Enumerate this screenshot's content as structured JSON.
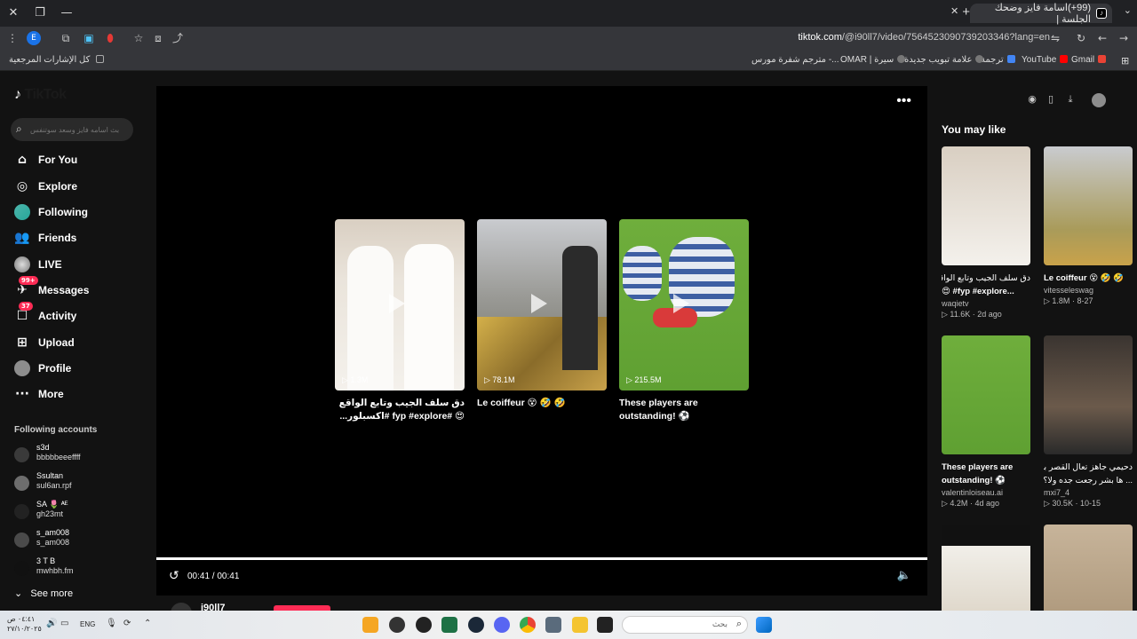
{
  "browser": {
    "tab_title": "(99+)اسامة فايز وضحك الجلسة |",
    "url_host": "tiktok.com",
    "url_path": "/@i90ll7/video/7564523090739203346?lang=en",
    "bookmarks": [
      {
        "label": "كل الإشارات المرجعية",
        "color": "#9aa0a6"
      },
      {
        "label": "Gmail",
        "color": "#ea4335"
      },
      {
        "label": "YouTube",
        "color": "#ff0000"
      },
      {
        "label": "ترجمة",
        "color": "#4285f4"
      },
      {
        "label": "علامة تبويب جديدة",
        "color": "#9aa0a6"
      },
      {
        "label": "OMAR | سيرة",
        "color": "#9aa0a6"
      },
      {
        "label": "مترجم شفرة مورس -...",
        "color": "#9aa0a6"
      }
    ]
  },
  "sidebar": {
    "logo": "TikTok",
    "search_placeholder": "بث اسامه فايز وسعد سوتنفس",
    "nav": [
      {
        "label": "For You",
        "icon": "home-icon"
      },
      {
        "label": "Explore",
        "icon": "compass-icon"
      },
      {
        "label": "Following",
        "icon": "following-avatar"
      },
      {
        "label": "Friends",
        "icon": "friends-icon"
      },
      {
        "label": "LIVE",
        "icon": "live-avatar"
      },
      {
        "label": "Messages",
        "icon": "messages-icon",
        "badge": "99+"
      },
      {
        "label": "Activity",
        "icon": "activity-icon",
        "badge": "37"
      },
      {
        "label": "Upload",
        "icon": "upload-icon"
      },
      {
        "label": "Profile",
        "icon": "profile-avatar"
      },
      {
        "label": "More",
        "icon": "more-icon"
      }
    ],
    "following_header": "Following accounts",
    "accounts": [
      {
        "user": "s3d",
        "name": "bbbbbeeeffff"
      },
      {
        "user": "Ssultan",
        "name": "sul6an.rpf"
      },
      {
        "user": "SA 🌷 ᴬᴱ",
        "name": "gh23mt"
      },
      {
        "user": "s_am008",
        "name": "s_am008"
      },
      {
        "user": "3 T B",
        "name": "mwhbh.fm"
      }
    ],
    "see_more": "See more"
  },
  "player": {
    "cards": [
      {
        "views": "1.3M",
        "caption": "دق سلف الجيب وتابع الواقع 😍 #fyp #explore #اكسبلور..."
      },
      {
        "views": "78.1M",
        "caption": "Le coiffeur 😵 🤣 🤣"
      },
      {
        "views": "215.5M",
        "caption": "These players are outstanding! ⚽"
      }
    ],
    "time": "00:41 / 00:41",
    "below_author": "i90ll7"
  },
  "right": {
    "heading": "You may like",
    "items": [
      {
        "caption": "دق سلف الجيب وتابع الواقع",
        "caption2": "😍 #fyp #explore...",
        "author": "waqietv",
        "views": "11.6K",
        "age": "2d ago"
      },
      {
        "caption": "Le coiffeur 😵 🤣 🤣",
        "caption2": "",
        "author": "vitesseleswag",
        "views": "1.8M",
        "age": "8-27"
      },
      {
        "caption": "These players are",
        "caption2": "outstanding! ⚽",
        "author": "valentinloiseau.ai",
        "views": "4.2M",
        "age": "4d ago"
      },
      {
        "caption": "دحيمي جاهز تعال القصر بس",
        "caption2": "... ها بشر رجعت جده ولا؟؟",
        "author": "mxi7_4",
        "views": "30.5K",
        "age": "10-15"
      },
      {
        "caption": "",
        "caption2": "",
        "author": "",
        "views": "",
        "age": ""
      },
      {
        "caption": "",
        "caption2": "",
        "author": "",
        "views": "",
        "age": ""
      }
    ]
  },
  "taskbar": {
    "search_placeholder": "بحث",
    "lang": "ENG",
    "clock_time": "٠٤:٤١ ص",
    "clock_date": "٢٧/١٠/٢٠٢٥"
  }
}
